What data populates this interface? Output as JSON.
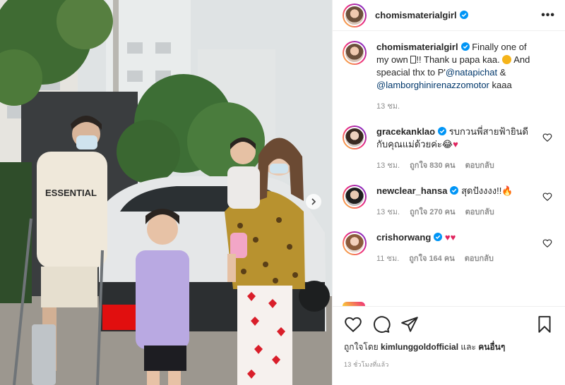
{
  "post": {
    "username": "chomismaterialgirl",
    "more_label": "•••"
  },
  "caption": {
    "username": "chomismaterialgirl",
    "text_part1": "Finally one of my own ",
    "text_part2": "!! Thank u papa kaa. ",
    "text_part3": " And speacial thx to P'",
    "mention1": "@natapichat",
    "amp": " & ",
    "mention2": "@lamborghinirenazzomotor",
    "text_end": " kaaa",
    "time": "13 ชม."
  },
  "comments": [
    {
      "username": "gracekanklao",
      "text": "รบกวนพี่สายฟ้ายินดีกับคุณแม่ด้วยค่ะ😂",
      "time": "13 ชม.",
      "likes": "ถูกใจ 830 คน",
      "reply": "ตอบกลับ"
    },
    {
      "username": "newclear_hansa",
      "text": "สุดปังงงง!!🔥",
      "time": "13 ชม.",
      "likes": "ถูกใจ 270 คน",
      "reply": "ตอบกลับ"
    },
    {
      "username": "crishorwang",
      "text": "",
      "time": "11 ชม.",
      "likes": "ถูกใจ 164 คน",
      "reply": "ตอบกลับ"
    }
  ],
  "likes": {
    "prefix": "ถูกใจโดย ",
    "user": "kimlunggoldofficial",
    "and": " และ ",
    "others": "คนอื่นๆ"
  },
  "posted_ago": "13 ชั่วโมงที่แล้ว",
  "photo": {
    "shirt_text": "ESSENTIAL"
  },
  "colors": {
    "verified": "#0095f6",
    "heart": "#ed4956",
    "mention": "#00376b"
  }
}
